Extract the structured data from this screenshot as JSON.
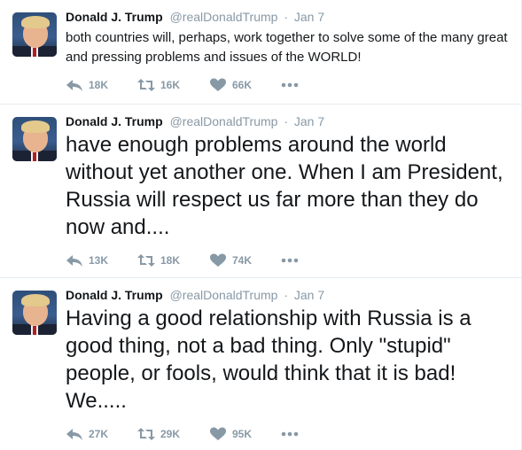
{
  "tweets": [
    {
      "name": "Donald J. Trump",
      "handle": "@realDonaldTrump",
      "separator": "·",
      "date": "Jan 7",
      "text": "both countries will, perhaps, work together to solve some of the many great and pressing problems and issues of the WORLD!",
      "replies": "18K",
      "retweets": "16K",
      "likes": "66K"
    },
    {
      "name": "Donald J. Trump",
      "handle": "@realDonaldTrump",
      "separator": "·",
      "date": "Jan 7",
      "text": "have enough problems around the world without yet another one. When I am President, Russia will respect us far more than they do now and....",
      "replies": "13K",
      "retweets": "18K",
      "likes": "74K"
    },
    {
      "name": "Donald J. Trump",
      "handle": "@realDonaldTrump",
      "separator": "·",
      "date": "Jan 7",
      "text": "Having a good relationship with Russia is a good thing, not a bad thing. Only \"stupid\" people, or fools, would think that it is bad! We.....",
      "replies": "27K",
      "retweets": "29K",
      "likes": "95K"
    }
  ],
  "icons": {
    "reply": "reply-icon",
    "retweet": "retweet-icon",
    "like": "heart-icon",
    "more": "more-icon"
  },
  "colors": {
    "text": "#14171a",
    "meta": "#8899a6",
    "divider": "#e6ecf0"
  }
}
